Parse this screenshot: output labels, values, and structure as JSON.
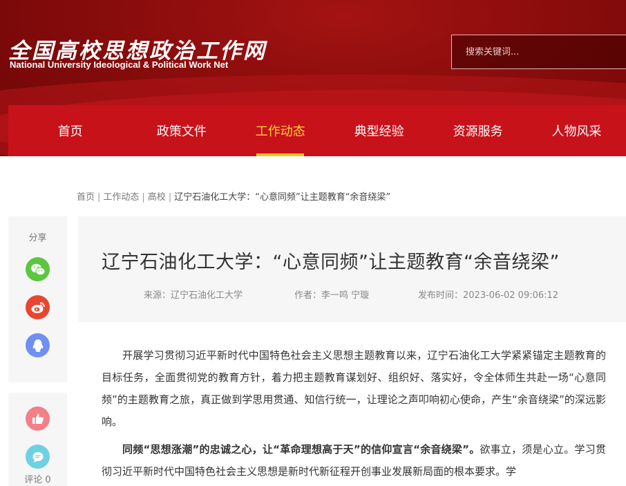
{
  "site": {
    "logo_cn": "全国高校思想政治工作网",
    "logo_en": "National University Ideological & Political Work Net"
  },
  "search": {
    "placeholder": "搜索关键词..."
  },
  "nav": [
    {
      "label": "首页"
    },
    {
      "label": "政策文件"
    },
    {
      "label": "工作动态",
      "active": true
    },
    {
      "label": "典型经验"
    },
    {
      "label": "资源服务"
    },
    {
      "label": "人物风采"
    }
  ],
  "breadcrumb": [
    "首页",
    "工作动态",
    "高校",
    "辽宁石油化工大学：“心意同频”让主题教育“余音绕梁”"
  ],
  "share": {
    "label": "分享",
    "icons": [
      "wechat-icon",
      "weibo-icon",
      "qq-icon"
    ]
  },
  "actions": {
    "icons": [
      "like-icon",
      "comment-icon"
    ],
    "comment_label": "评论 0"
  },
  "article": {
    "title": "辽宁石油化工大学：“心意同频”让主题教育“余音绕梁”",
    "source": "来源：辽宁石油化工大学",
    "author": "作者：李一鸣 宁璇",
    "time": "发布时间：2023-06-02 09:06:12",
    "p1": "开展学习贯彻习近平新时代中国特色社会主义思想主题教育以来，辽宁石油化工大学紧紧锚定主题教育的目标任务，全面贯彻党的教育方针，着力把主题教育谋划好、组织好、落实好，令全体师生共赴一场“心意同频”的主题教育之旅，真正做到学思用贯通、知信行统一，让理论之声叩响初心使命，产生“余音绕梁”的深远影响。",
    "p2_bold": "同频“思想涨潮”的忠诚之心，让“革命理想高于天”的信仰宣言“余音绕梁”。",
    "p2_rest": "欲事立，须是心立。学习贯彻习近平新时代中国特色社会主义思想是新时代新征程开创事业发展新局面的根本要求。学"
  },
  "colors": {
    "brand_red": "#c8121a",
    "header_dark": "#8a0c0c",
    "active_nav": "#ffd23a"
  }
}
